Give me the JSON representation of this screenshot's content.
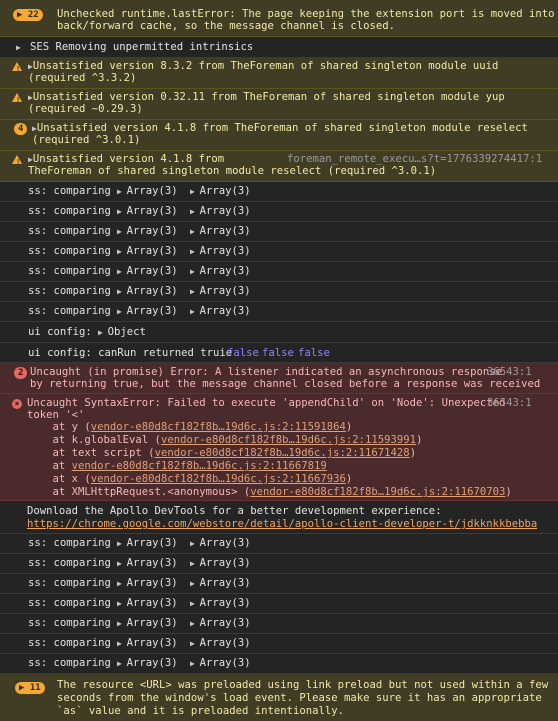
{
  "warn_top": {
    "count": "22",
    "text1": "Unchecked runtime.lastError: The page keeping the extension port is moved into",
    "text2": "back/forward cache, so the message channel is closed."
  },
  "ses": {
    "text": "SES Removing unpermitted intrinsics"
  },
  "warn_uuid": {
    "text1": "Unsatisfied version 8.3.2 from TheForeman of shared singleton module uuid",
    "text2": "(required ^3.3.2)"
  },
  "warn_yup": {
    "text1": "Unsatisfied version 0.32.11 from TheForeman of shared singleton module yup",
    "text2": "(required ~0.29.3)"
  },
  "warn_reselect": {
    "count": "4",
    "text1": "Unsatisfied version 4.1.8 from TheForeman of shared singleton module reselect",
    "text2": "(required ^3.0.1)"
  },
  "warn_reselect2": {
    "text1": "Unsatisfied version 4.1.8 from",
    "source": "foreman_remote_execu…s?t=1776339274417:1",
    "text2": "TheForeman of shared singleton module reselect (required ^3.0.1)"
  },
  "ss_label": "ss: comparing",
  "array_label": "Array(3)",
  "ui_config_object": {
    "label": "ui config:",
    "value": "Object"
  },
  "ui_config_canrun": {
    "text": "ui config: canRun returned truie",
    "b1": "false",
    "b2": "false",
    "b3": "false"
  },
  "uncaught_promise": {
    "count": "2",
    "text1": "Uncaught (in promise) Error: A listener indicated an asynchronous response",
    "source": "36543:1",
    "text2": "by returning true, but the message channel closed before a response was received"
  },
  "syntax_error": {
    "text1": "Uncaught SyntaxError: Failed to execute 'appendChild' on 'Node': Unexpected",
    "source": "36543:1",
    "text2": "token '<'",
    "stack": [
      {
        "prefix": "    at y (",
        "link": "vendor-e80d8cf182f8b…19d6c.js:2:11591864",
        "suffix": ")"
      },
      {
        "prefix": "    at k.globalEval (",
        "link": "vendor-e80d8cf182f8b…19d6c.js:2:11593991",
        "suffix": ")"
      },
      {
        "prefix": "    at text script (",
        "link": "vendor-e80d8cf182f8b…19d6c.js:2:11671428",
        "suffix": ")"
      },
      {
        "prefix": "    at ",
        "link": "vendor-e80d8cf182f8b…19d6c.js:2:11667819",
        "suffix": ""
      },
      {
        "prefix": "    at x (",
        "link": "vendor-e80d8cf182f8b…19d6c.js:2:11667936",
        "suffix": ")"
      },
      {
        "prefix": "    at XMLHttpRequest.<anonymous> (",
        "link": "vendor-e80d8cf182f8b…19d6c.js:2:11670703",
        "suffix": ")"
      }
    ]
  },
  "apollo": {
    "text": "Download the Apollo DevTools for a better development experience:",
    "link": "https://chrome.google.com/webstore/detail/apollo-client-developer-t/jdkknkkbebbapil…"
  },
  "warn_bottom": {
    "count": "11",
    "text1": "The resource <URL> was preloaded using link preload but not used within a few",
    "text2": "seconds from the window's load event. Please make sure it has an appropriate",
    "text3": "`as` value and it is preloaded intentionally."
  }
}
